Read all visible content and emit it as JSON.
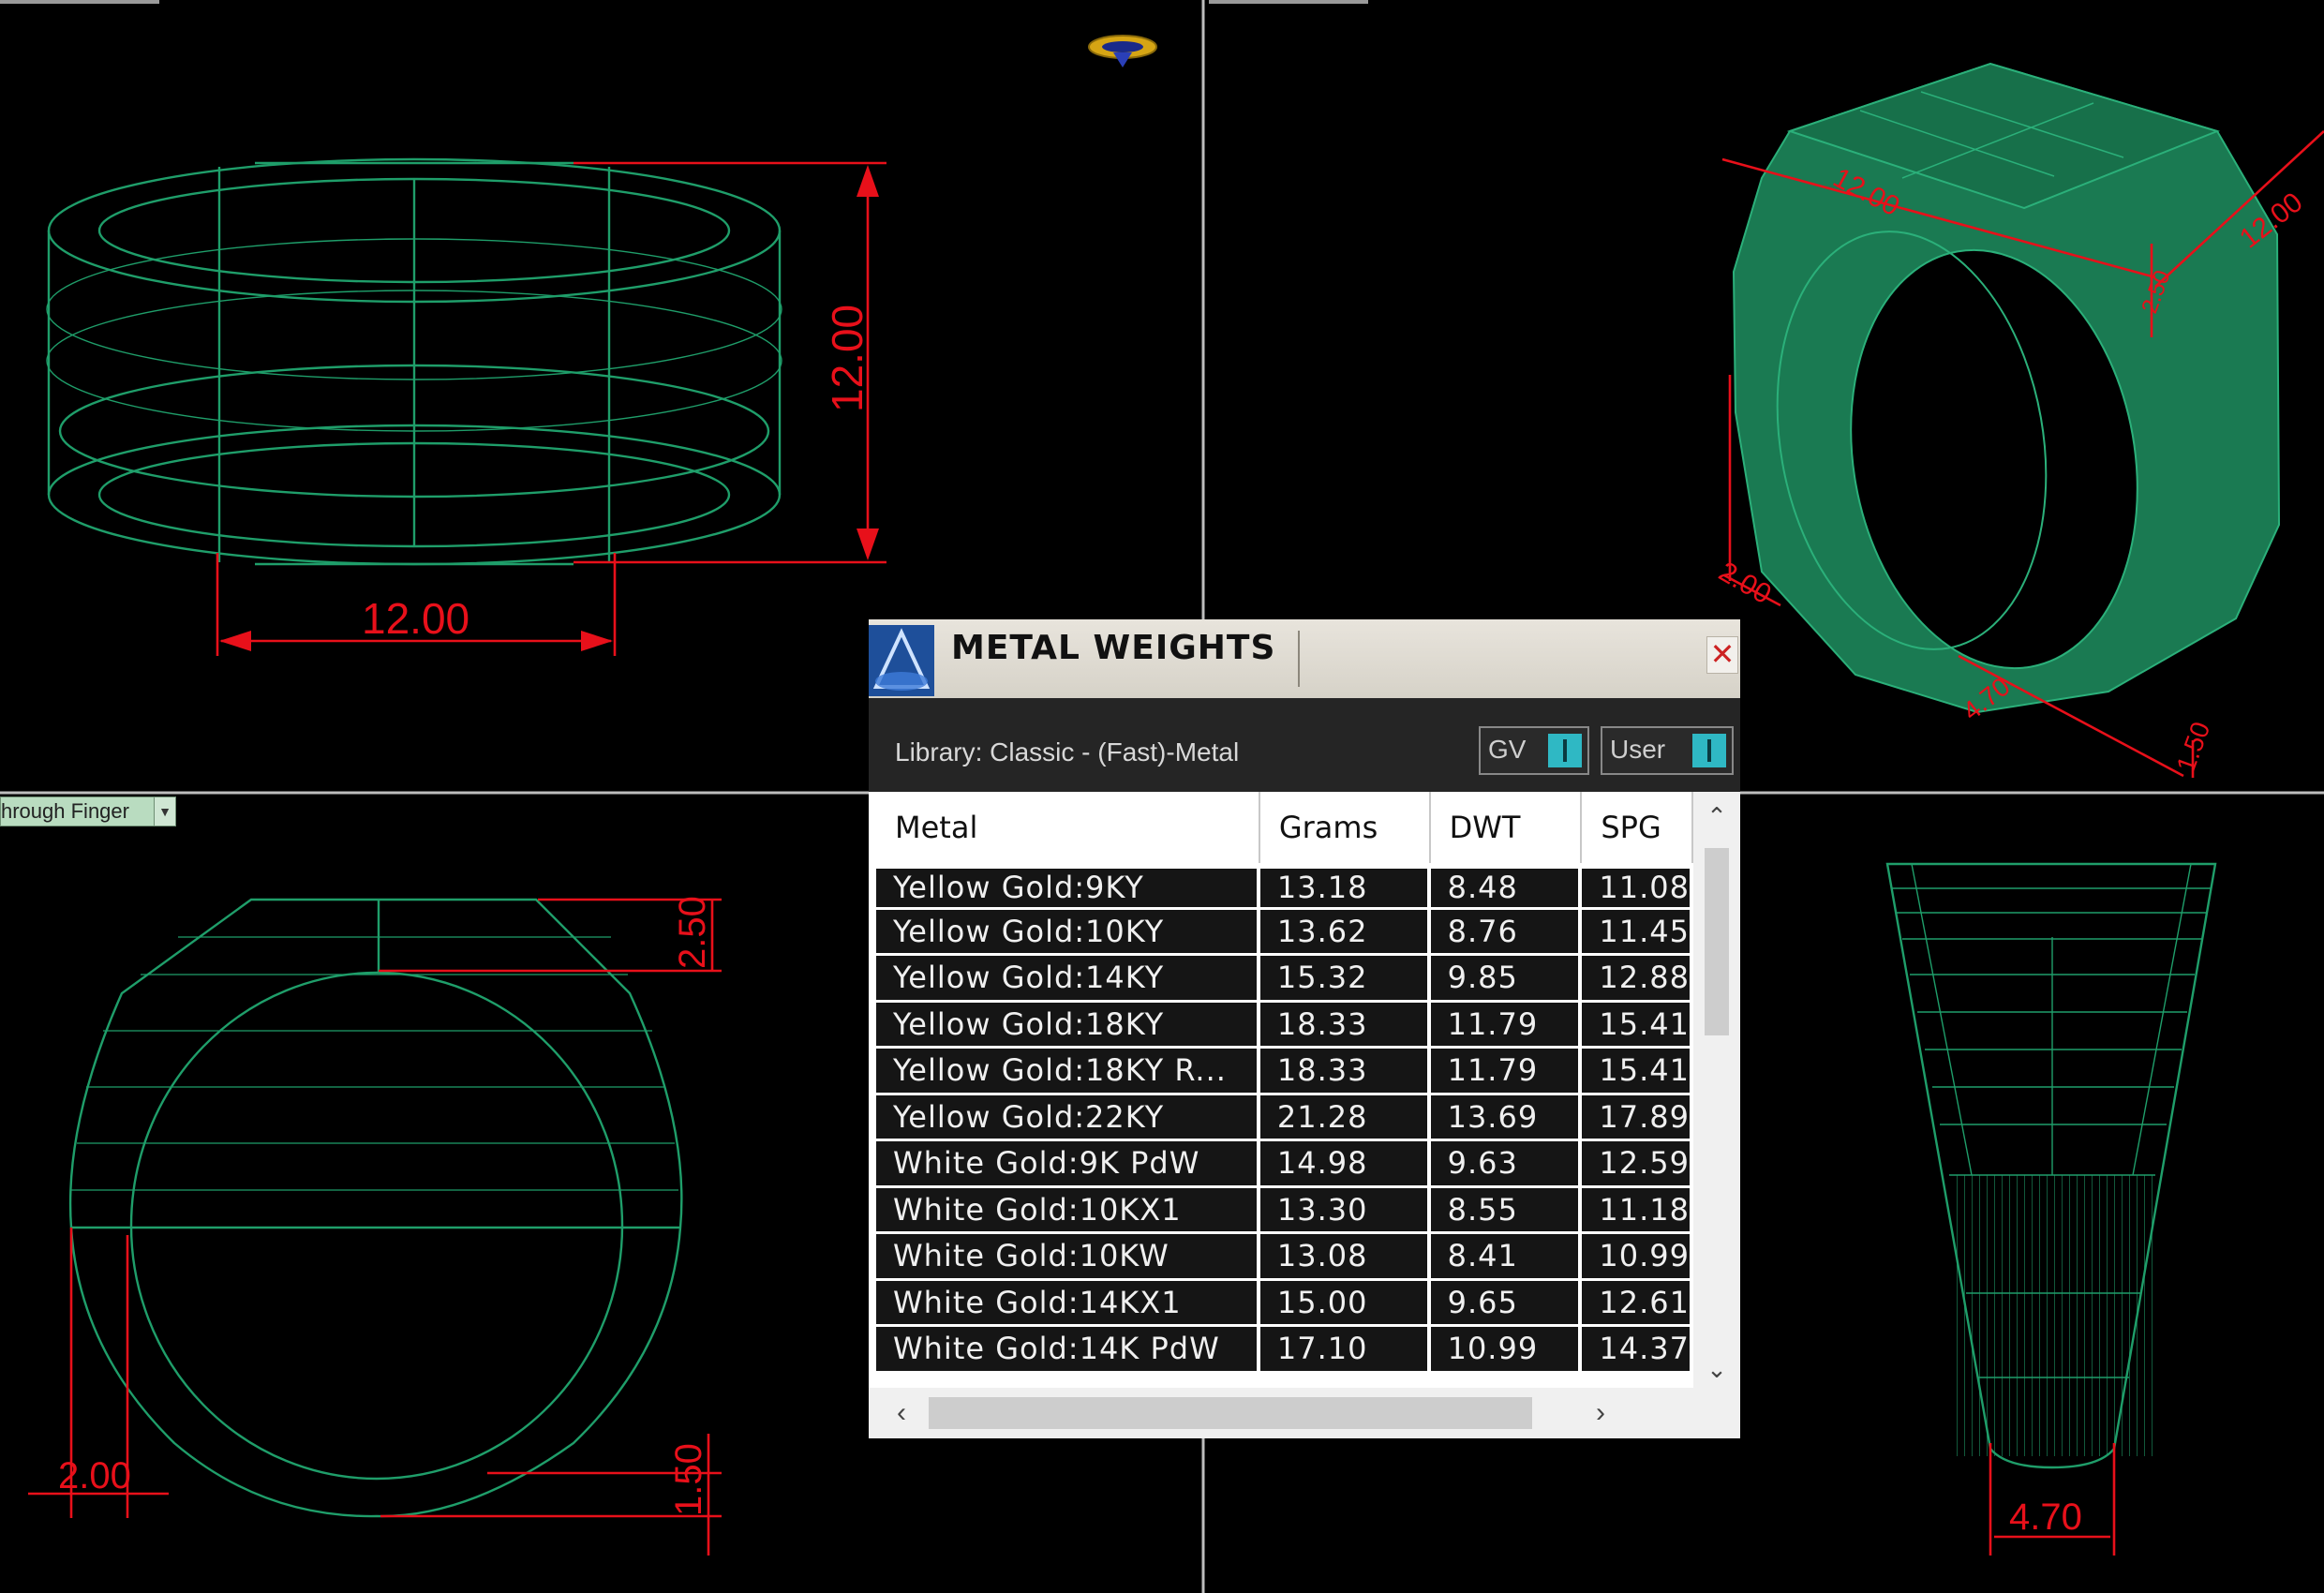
{
  "viewports": {
    "top_left": {
      "dims": {
        "width": "12.00",
        "height": "12.00"
      }
    },
    "top_right": {
      "dims": {
        "top_length": "12.00",
        "top_width": "12.00",
        "top_thickness": "2.50",
        "shank_height": "2.00",
        "bottom_width": "4.70",
        "bottom_thickness": "1.50"
      }
    },
    "bottom_left": {
      "dropdown_label": "hrough Finger",
      "dims": {
        "top_thickness": "2.50",
        "side_width": "2.00",
        "bottom_thickness": "1.50"
      }
    },
    "bottom_right": {
      "dims": {
        "bottom_width": "4.70"
      }
    }
  },
  "dialog": {
    "title": "METAL WEIGHTS",
    "close_label": "✕",
    "library_label": "Library: Classic - (Fast)-Metal",
    "toggles": [
      {
        "label": "GV"
      },
      {
        "label": "User"
      }
    ],
    "columns": [
      "Metal",
      "Grams",
      "DWT",
      "SPG"
    ],
    "rows": [
      [
        "Yellow Gold:9KY",
        "13.18",
        "8.48",
        "11.08"
      ],
      [
        "Yellow Gold:10KY",
        "13.62",
        "8.76",
        "11.45"
      ],
      [
        "Yellow Gold:14KY",
        "15.32",
        "9.85",
        "12.88"
      ],
      [
        "Yellow Gold:18KY",
        "18.33",
        "11.79",
        "15.41"
      ],
      [
        "Yellow Gold:18KY R...",
        "18.33",
        "11.79",
        "15.41"
      ],
      [
        "Yellow Gold:22KY",
        "21.28",
        "13.69",
        "17.89"
      ],
      [
        "White Gold:9K PdW",
        "14.98",
        "9.63",
        "12.59"
      ],
      [
        "White Gold:10KX1",
        "13.30",
        "8.55",
        "11.18"
      ],
      [
        "White Gold:10KW",
        "13.08",
        "8.41",
        "10.99"
      ],
      [
        "White Gold:14KX1",
        "15.00",
        "9.65",
        "12.61"
      ],
      [
        "White Gold:14K PdW",
        "17.10",
        "10.99",
        "14.37"
      ]
    ],
    "scroll_icons": {
      "up": "chevron-up-icon",
      "down": "chevron-down-icon",
      "left": "chevron-left-icon",
      "right": "chevron-right-icon"
    }
  },
  "colors": {
    "wire": "#1f9e6a",
    "dimension": "#e8101a",
    "toggle_knob": "#2fb8c4"
  }
}
